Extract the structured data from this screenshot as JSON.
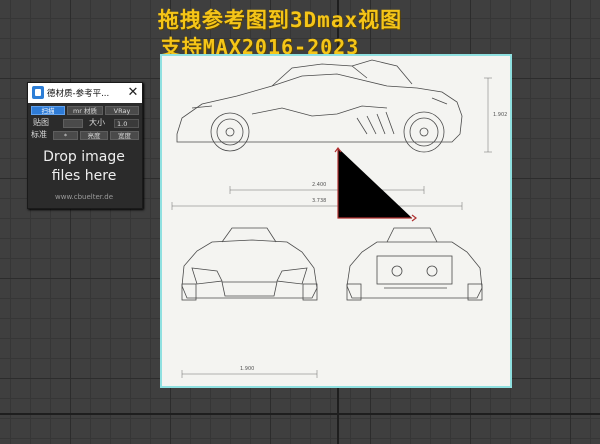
{
  "title": {
    "line1": "拖拽参考图到3Dmax视图",
    "line2": "支持MAX2016-2023"
  },
  "panel": {
    "window_title": "德材质-参考平...",
    "close_glyph": "✕",
    "renderers": [
      "扫描",
      "mr 材质",
      "VRay"
    ],
    "label_a": "贴图",
    "size_label": "大小",
    "size_value": "1.0",
    "mode_buttons": [
      "标准",
      "*",
      "亮度",
      "宽度"
    ],
    "mode_label": "标准",
    "drop_text": "Drop image files here",
    "drop_line1": "Drop image",
    "drop_line2": "files here",
    "credit": "www.cbuelter.de"
  },
  "drawing": {
    "dims": [
      "2.400",
      "3.738",
      "1.900",
      "1.902"
    ]
  },
  "colors": {
    "title": "#f5c518",
    "active_button": "#2e7bd6",
    "frame_border": "#8fe0e0",
    "gizmo": "#b03030"
  }
}
